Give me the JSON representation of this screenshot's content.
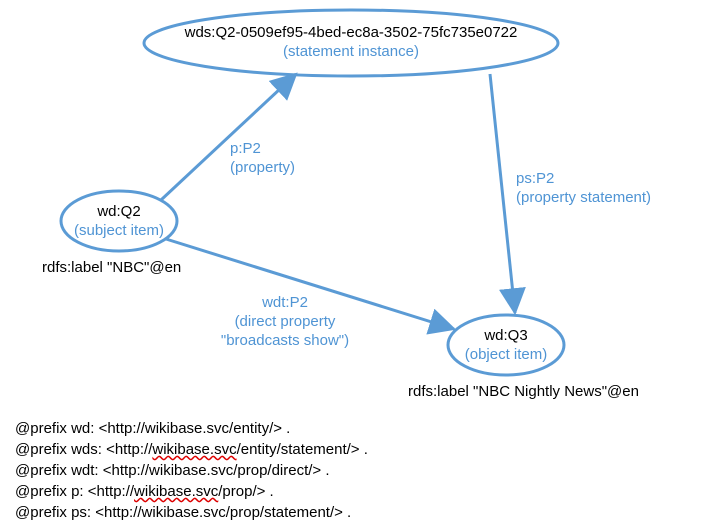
{
  "nodes": {
    "statement": {
      "name": "wds:Q2-0509ef95-4bed-ec8a-3502-75fc735e0722",
      "role": "(statement instance)"
    },
    "subject": {
      "name": "wd:Q2",
      "role": "(subject item)",
      "rdfs_label": "rdfs:label \"NBC\"@en"
    },
    "object": {
      "name": "wd:Q3",
      "role": "(object item)",
      "rdfs_label": "rdfs:label \"NBC Nightly News\"@en"
    }
  },
  "edges": {
    "p": {
      "line1": "p:P2",
      "line2": "(property)"
    },
    "ps": {
      "line1": "ps:P2",
      "line2": "(property statement)"
    },
    "wdt": {
      "line1": "wdt:P2",
      "line2": "(direct property",
      "line3": "\"broadcasts show\")"
    }
  },
  "prefixes": {
    "wd": "@prefix wd: <http://wikibase.svc/entity/> .",
    "wds_a": "@prefix wds: <http://",
    "wds_b": "wikibase.svc",
    "wds_c": "/entity/statement/> .",
    "wdt": "@prefix wdt: <http://wikibase.svc/prop/direct/> .",
    "p_a": "@prefix p: <http://",
    "p_b": "wikibase.svc",
    "p_c": "/prop/> .",
    "ps": "@prefix ps: <http://wikibase.svc/prop/statement/> ."
  }
}
